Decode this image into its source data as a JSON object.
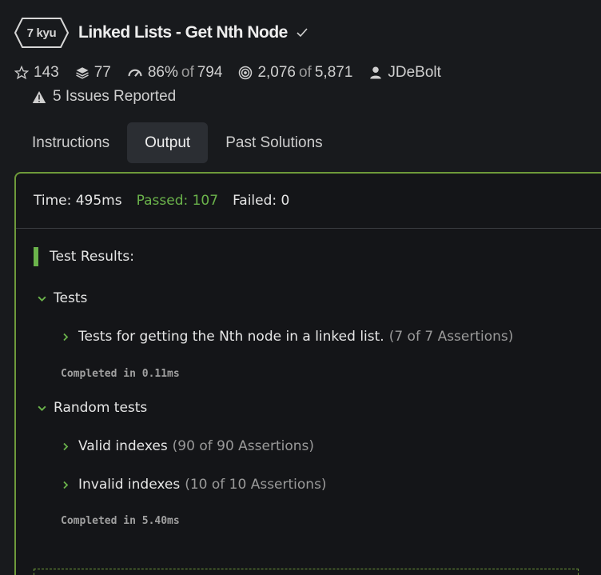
{
  "kata": {
    "rank": "7 kyu",
    "title": "Linked Lists - Get Nth Node"
  },
  "stats": {
    "stars": "143",
    "collections": "77",
    "satisfaction_pct": "86%",
    "of_label": "of",
    "satisfaction_total": "794",
    "completed": "2,076",
    "completed_total": "5,871",
    "author": "JDeBolt",
    "issues": "5 Issues Reported"
  },
  "tabs": [
    {
      "label": "Instructions",
      "active": false
    },
    {
      "label": "Output",
      "active": true
    },
    {
      "label": "Past Solutions",
      "active": false
    }
  ],
  "output": {
    "time": "Time: 495ms",
    "passed": "Passed: 107",
    "failed": "Failed: 0",
    "results_heading": "Test Results:",
    "groups": [
      {
        "name": "Tests",
        "items": [
          {
            "label": "Tests for getting the Nth node in a linked list.",
            "assertions": "(7 of 7 Assertions)"
          }
        ],
        "completed": "Completed in 0.11ms"
      },
      {
        "name": "Random tests",
        "items": [
          {
            "label": "Valid indexes",
            "assertions": "(90 of 90 Assertions)"
          },
          {
            "label": "Invalid indexes",
            "assertions": "(10 of 10 Assertions)"
          }
        ],
        "completed": "Completed in 5.40ms"
      }
    ]
  },
  "colors": {
    "accent_green": "#6bb34b",
    "panel_border": "#6e9a3a",
    "background": "#181a1d"
  },
  "icons": [
    "star-icon",
    "stack-icon",
    "satisfaction-gauge-icon",
    "target-icon",
    "user-icon",
    "warning-icon",
    "checkmark-icon",
    "chevron-down-icon",
    "chevron-right-icon"
  ]
}
